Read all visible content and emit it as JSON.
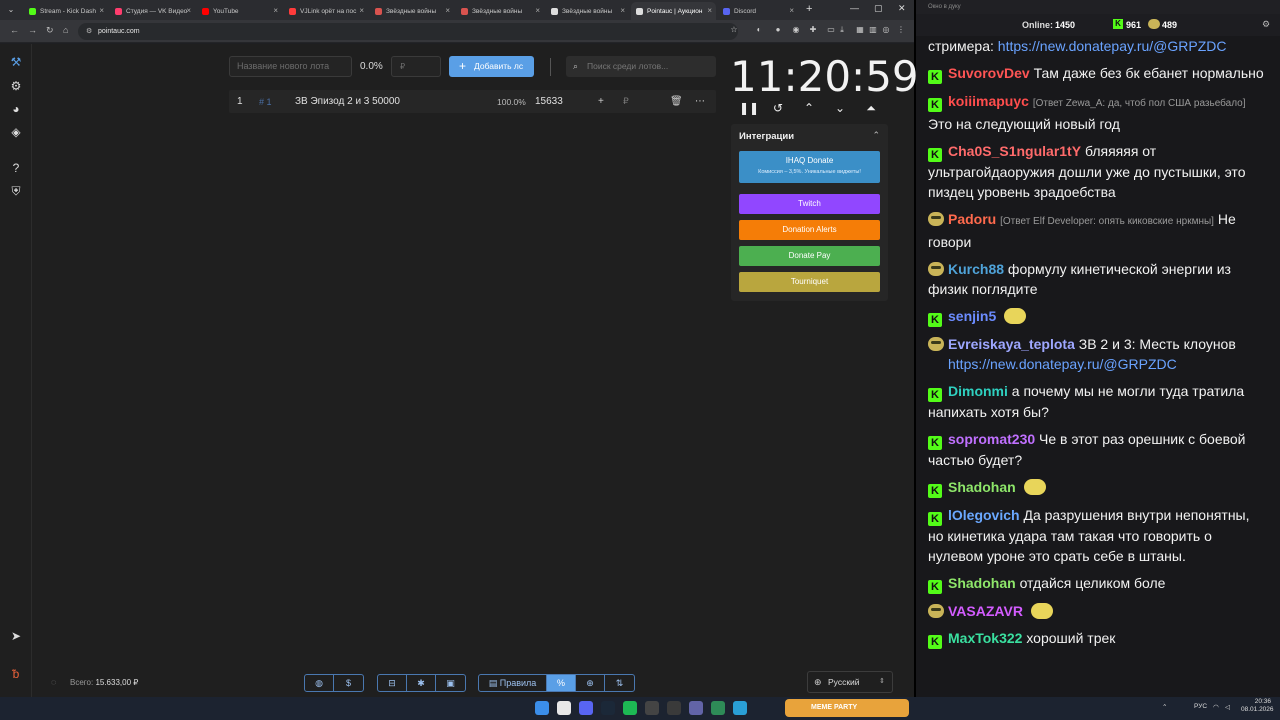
{
  "browser": {
    "tabs": [
      {
        "title": "Stream - Kick Dash",
        "color": "#53fc18"
      },
      {
        "title": "Студия — VK Видео",
        "color": "#ff3d6e"
      },
      {
        "title": "YouTube",
        "color": "#ff0000"
      },
      {
        "title": "VJLink орёт на пос",
        "color": "#ff3b3b"
      },
      {
        "title": "Звёздные войны",
        "color": "#d9534f"
      },
      {
        "title": "Звёздные войны",
        "color": "#d9534f"
      },
      {
        "title": "Звёздные войны",
        "color": "#dddddd"
      },
      {
        "title": "Pointauc | Аукцион",
        "color": "#dddddd"
      },
      {
        "title": "Discord",
        "color": "#5865f2"
      }
    ],
    "url": "pointauc.com"
  },
  "auction": {
    "new_lot_placeholder": "Название нового лота",
    "percent": "0.0%",
    "amount_placeholder": "₽",
    "add_button": "Добавить лс",
    "search_placeholder": "Поиск среди лотов...",
    "lots": [
      {
        "index": "1",
        "fast_id": "# 1",
        "name": "ЗВ Эпизод 2 и 3 50000",
        "percent": "100.0%",
        "amount": "15633",
        "currency": "₽"
      }
    ],
    "timer": "11:20:59",
    "integrations": {
      "title": "Интеграции",
      "ihaq_label": "IHAQ Donate",
      "ihaq_sub": "Комиссия – 3,5%. Уникальные виджеты!",
      "buttons": [
        {
          "label": "Twitch",
          "color": "#9147ff"
        },
        {
          "label": "Donation Alerts",
          "color": "#f57d07"
        },
        {
          "label": "Donate Pay",
          "color": "#4caf50"
        },
        {
          "label": "Tourniquet",
          "color": "#b9a63e"
        }
      ]
    },
    "total_label": "Всего:",
    "total_value": "15.633,00 ₽",
    "rules_label": "Правила",
    "language": "Русский"
  },
  "chat": {
    "window_title": "Окно в дуку",
    "online_label": "Online:",
    "online_count": "1450",
    "count_a": "961",
    "count_b": "489",
    "messages": [
      {
        "user": "",
        "color": "#f2f2f2",
        "reply": "",
        "text": "стримера: ",
        "link": "https://new.donatepay.ru/@GRPZDC",
        "badge": "none"
      },
      {
        "user": "SuvorovDev",
        "color": "#ff5555",
        "reply": "",
        "text": "Там даже без бк ебанет нормально",
        "link": "",
        "badge": "k"
      },
      {
        "user": "koiiimapuyc",
        "color": "#ff4d4d",
        "reply": "[Ответ Zewa_A: да, чтоб пол США разьебало]",
        "text": "Это на следующий новый год",
        "link": "",
        "badge": "k"
      },
      {
        "user": "Cha0S_S1ngular1tY",
        "color": "#ff6b6b",
        "reply": "",
        "text": "бляяяяя от ультрагойдаоружия дошли уже до пустышки, это пиздец уровень зрадоебства",
        "link": "",
        "badge": "k"
      },
      {
        "user": "Padoru",
        "color": "#ff6a4d",
        "reply": "[Ответ Elf Developer: опять киковские нркмны]",
        "text": "Не говори",
        "link": "",
        "badge": "pepe"
      },
      {
        "user": "Kurch88",
        "color": "#4fa3d9",
        "reply": "",
        "text": "формулу кинетической энергии из физик поглядите",
        "link": "",
        "badge": "pepe"
      },
      {
        "user": "senjin5",
        "color": "#6c8cff",
        "reply": "",
        "text": "",
        "link": "",
        "badge": "k"
      },
      {
        "user": "Evreiskaya_teplota",
        "color": "#9ea7ff",
        "reply": "",
        "text": "ЗВ 2 и 3: Месть клоунов",
        "link": "https://new.donatepay.ru/@GRPZDC",
        "badge": "pepe"
      },
      {
        "user": "Dimonmi",
        "color": "#2fd0c0",
        "reply": "",
        "text": "а почему мы не могли туда тратила напихать хотя бы?",
        "link": "",
        "badge": "k"
      },
      {
        "user": "sopromat230",
        "color": "#c070ff",
        "reply": "",
        "text": "Че в этот раз орешник с боевой частью будет?",
        "link": "",
        "badge": "k"
      },
      {
        "user": "Shadohan",
        "color": "#8ee66a",
        "reply": "",
        "text": "",
        "link": "",
        "badge": "k"
      },
      {
        "user": "lOlegovich",
        "color": "#6aa8ff",
        "reply": "",
        "text": "Да разрушения внутри непонятны, но кинетика удара там такая что говорить о нулевом уроне это срать себе в штаны.",
        "link": "",
        "badge": "k"
      },
      {
        "user": "Shadohan",
        "color": "#8ee66a",
        "reply": "",
        "text": "отдайся целиком боле",
        "link": "",
        "badge": "k"
      },
      {
        "user": "VASAZAVR",
        "color": "#d35cff",
        "reply": "",
        "text": "",
        "link": "",
        "badge": "pepe"
      },
      {
        "user": "MaxTok322",
        "color": "#3ae0a0",
        "reply": "",
        "text": "хороший трек",
        "link": "",
        "badge": "k"
      }
    ]
  },
  "taskbar": {
    "lang": "РУС",
    "time": "20:36",
    "date": "08.01.2026",
    "widget": "MEME PARTY"
  }
}
